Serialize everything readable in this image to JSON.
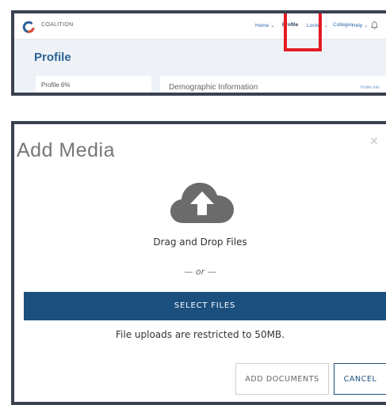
{
  "header": {
    "brand": "COALITION",
    "nav": [
      {
        "label": "Home ⌄"
      },
      {
        "label": "Profile"
      },
      {
        "label": "Locker ⌄"
      },
      {
        "label": "Colleges"
      },
      {
        "label": "Help ⌄"
      }
    ]
  },
  "profile": {
    "title": "Profile",
    "progress_label": "Profile 6%",
    "section_title": "Demographic Information",
    "side_link": "Profile Info"
  },
  "modal": {
    "title": "Add Media",
    "close_glyph": "✕",
    "drag_text": "Drag and Drop Files",
    "or_text": "— or —",
    "select_label": "SELECT FILES",
    "restriction_text": "File uploads are restricted to 50MB.",
    "add_documents_label": "ADD DOCUMENTS",
    "cancel_label": "CANCEL"
  },
  "colors": {
    "primary": "#1b4f7e",
    "highlight": "#e41b23",
    "profile_title": "#2a6496",
    "cloud_icon": "#6b6b6b"
  },
  "icons": {
    "logo": "coalition-logo-icon",
    "bell": "bell-icon",
    "upload": "cloud-upload-icon",
    "close": "close-icon"
  }
}
